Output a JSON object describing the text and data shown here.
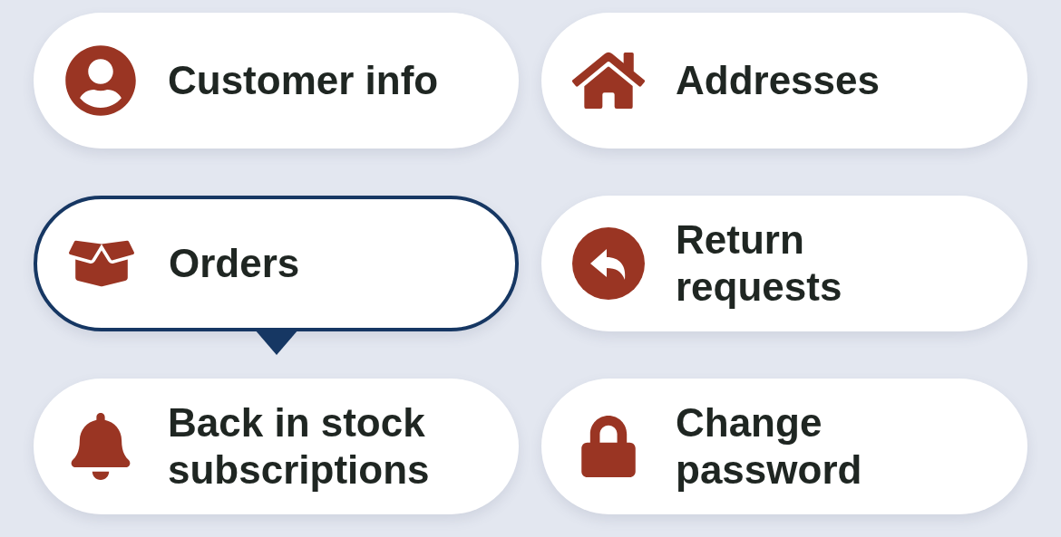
{
  "menu": [
    {
      "label": "Customer info",
      "selected": false
    },
    {
      "label": "Addresses",
      "selected": false
    },
    {
      "label": "Orders",
      "selected": true
    },
    {
      "label": "Return\nrequests",
      "selected": false
    },
    {
      "label": "Back in stock\nsubscriptions",
      "selected": false
    },
    {
      "label": "Change\npassword",
      "selected": false
    }
  ]
}
